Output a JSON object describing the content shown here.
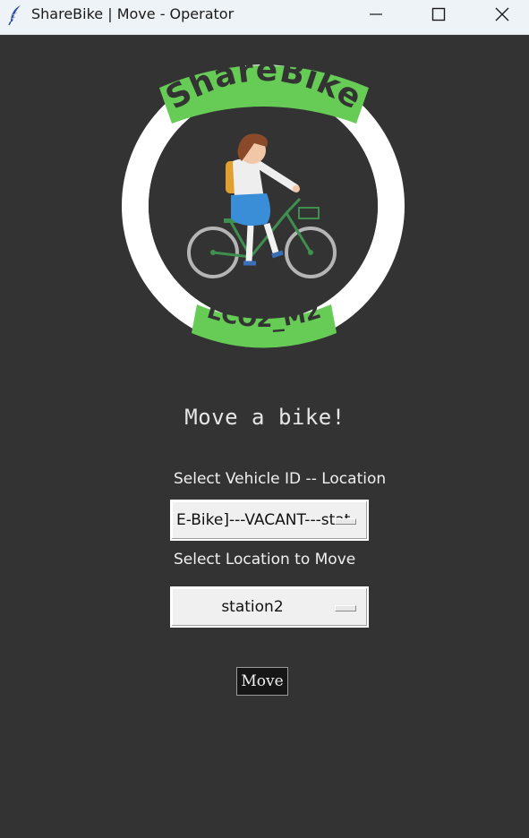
{
  "window": {
    "title": "ShareBike | Move - Operator"
  },
  "logo": {
    "brand": "ShareBike",
    "tag": "LCO2_M2",
    "accent": "#66cc55"
  },
  "main": {
    "heading": "Move a bike!",
    "vehicle_label": "Select Vehicle ID -- Location",
    "vehicle_selected": "E-Bike]---VACANT---stat",
    "location_label": "Select Location to Move",
    "location_selected": "station2",
    "move_label": "Move"
  }
}
